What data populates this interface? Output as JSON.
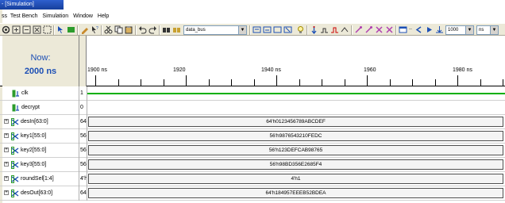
{
  "window": {
    "title": "- [Simulation]"
  },
  "menu": {
    "items": [
      "ss",
      "Test Bench",
      "Simulation",
      "Window",
      "Help"
    ]
  },
  "toolbar": {
    "signal_combo": "data_bus",
    "time_value": "1000",
    "time_unit": "ns"
  },
  "header": {
    "now_label": "Now:",
    "now_time": "2000 ns",
    "time_labels": [
      "1900 ns",
      "1920",
      "1940 ns",
      "1960",
      "1980 ns"
    ]
  },
  "signals": [
    {
      "name": "clk",
      "value": "1",
      "type": "bit"
    },
    {
      "name": "decrypt",
      "value": "0",
      "type": "bit"
    },
    {
      "name": "desIn[63:0]",
      "value": "64'h...",
      "type": "bus",
      "wave": "64'h0123456789ABCDEF"
    },
    {
      "name": "key1[55:0]",
      "value": "56'h...",
      "type": "bus",
      "wave": "56'h9876543210FEDC"
    },
    {
      "name": "key2[55:0]",
      "value": "56'h...",
      "type": "bus",
      "wave": "56'h123DEFCAB98765"
    },
    {
      "name": "key3[55:0]",
      "value": "56'h...",
      "type": "bus",
      "wave": "56'h98BD356E2685F4"
    },
    {
      "name": "roundSel[1:4]",
      "value": "4'h1",
      "type": "bus",
      "wave": "4'h1"
    },
    {
      "name": "desOut[63:0]",
      "value": "64'h...",
      "type": "bus",
      "wave": "64'h184957EEEB52BDEA"
    }
  ],
  "colors": {
    "titlebar": "#1c4fb5",
    "bit_wave": "#00b000",
    "now_text": "#1c4fb5"
  }
}
